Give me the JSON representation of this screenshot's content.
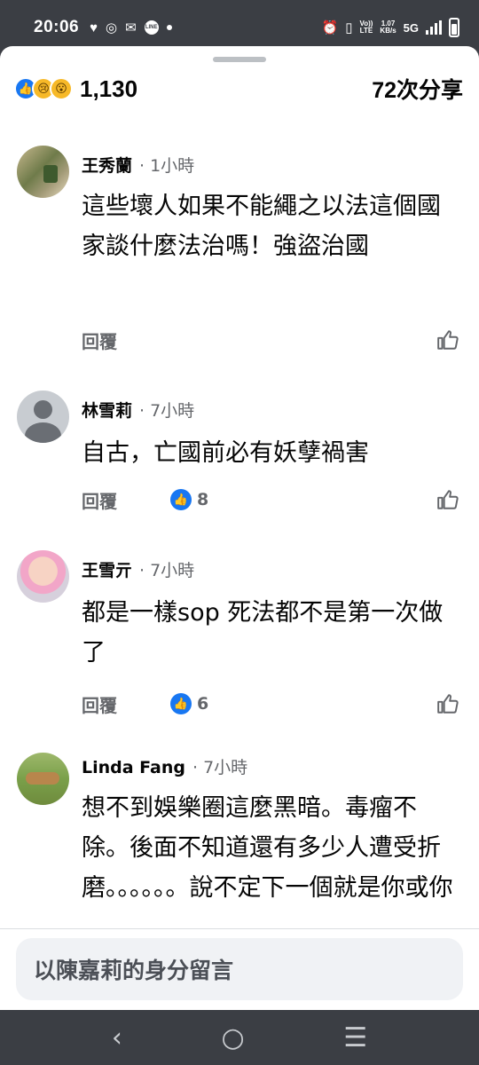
{
  "status_bar": {
    "time": "20:06",
    "line_label": "LINE",
    "volte_top": "Vo))",
    "volte_bottom": "LTE",
    "speed_top": "1.07",
    "speed_bottom": "KB/s",
    "network": "5G"
  },
  "post_stats": {
    "reactions": [
      "like",
      "sad",
      "wow"
    ],
    "reaction_count": "1,130",
    "share_count": "72次分享"
  },
  "comments": [
    {
      "name": "王秀蘭",
      "time": "· 1小時",
      "text": "這些壞人如果不能繩之以法這個國家談什麼法治嗎￼！強盜治國",
      "reply": "回覆",
      "likes": ""
    },
    {
      "name": "林雪莉",
      "time": "· 7小時",
      "text": "自古，亡國前必有妖孽禍害",
      "reply": "回覆",
      "likes": "8"
    },
    {
      "name": "王雪亓",
      "time": "· 7小時",
      "text": "都是一樣sop 死法都不是第一次做了",
      "reply": "回覆",
      "likes": "6"
    },
    {
      "name": "Linda Fang",
      "time": "· 7小時",
      "text": "想不到娛樂圈這麼黑暗。毒瘤不除。後面不知道還有多少人遭受折磨。。。。。。說不定下一個就是你或你",
      "reply": "回覆",
      "likes": ""
    }
  ],
  "composer": {
    "placeholder": "以陳嘉莉的身分留言"
  },
  "colors": {
    "accent": "#1877f2",
    "secondary_text": "#65676b",
    "system_bar": "#3b3e44"
  }
}
